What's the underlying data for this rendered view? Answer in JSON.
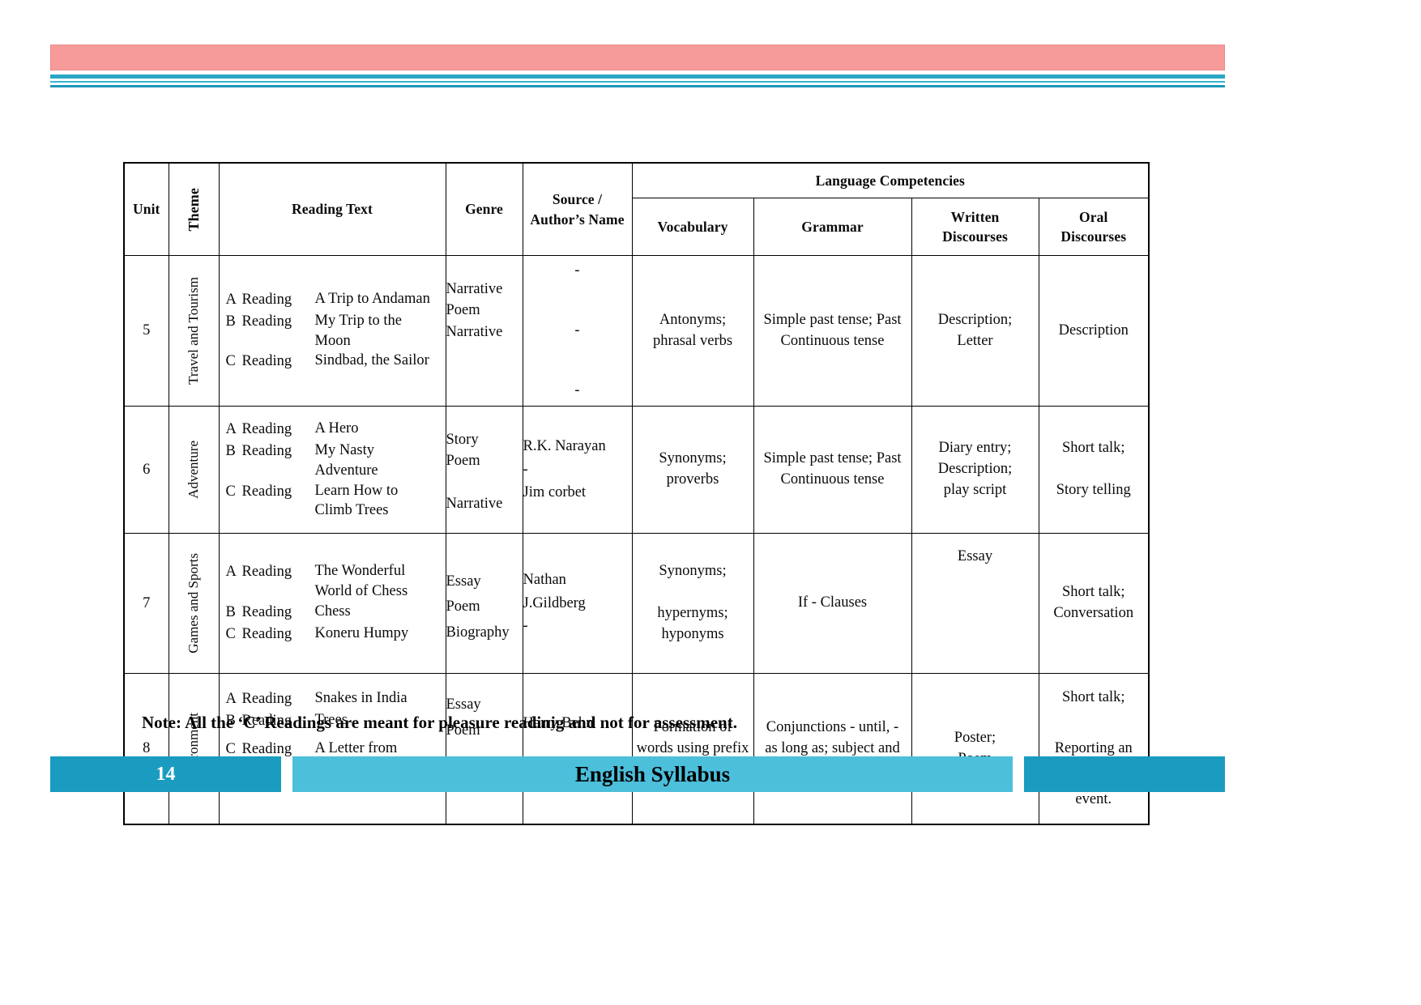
{
  "page": {
    "number": "14",
    "footer_title": "English Syllabus",
    "note": "Note: All the ‘C’ Readings are meant for pleasure readinig and not for assessment."
  },
  "colors": {
    "header_pink": "#f79a9a",
    "header_teal": "#2aa7c4",
    "footer_dark_teal": "#1a9cc0",
    "footer_light_teal": "#4cbfdb"
  },
  "table": {
    "headers": {
      "unit": "Unit",
      "theme": "Theme",
      "reading_text": "Reading Text",
      "genre": "Genre",
      "source": "Source /\nAuthor’s Name",
      "language_competencies": "Language Competencies",
      "vocabulary": "Vocabulary",
      "grammar": "Grammar",
      "written_discourses": "Written\nDiscourses",
      "oral_discourses": "Oral\nDiscourses"
    },
    "rows": [
      {
        "unit": "5",
        "theme": "Travel and\nTourism",
        "readings": [
          {
            "letter": "A",
            "label": "Reading",
            "title": "A Trip to Andaman"
          },
          {
            "letter": "B",
            "label": "Reading",
            "title": "My Trip to the Moon"
          },
          {
            "letter": "C",
            "label": "Reading",
            "title": "Sindbad, the Sailor"
          }
        ],
        "genre": "Narrative\nPoem\nNarrative",
        "source": "-\n\n-\n\n-",
        "vocabulary": "Antonyms;\nphrasal  verbs",
        "grammar": "Simple past tense; Past\nContinuous  tense",
        "written": "Description;\nLetter",
        "oral": "Description"
      },
      {
        "unit": "6",
        "theme": "Adventure",
        "readings": [
          {
            "letter": "A",
            "label": "Reading",
            "title": "A Hero"
          },
          {
            "letter": "B",
            "label": "Reading",
            "title": "My Nasty Adventure"
          },
          {
            "letter": "C",
            "label": "Reading",
            "title": "Learn How to\nClimb Trees"
          }
        ],
        "genre": "Story\nPoem\n\nNarrative",
        "source": "R.K. Narayan\n-\nJim corbet",
        "vocabulary": "Synonyms;\nproverbs",
        "grammar": "Simple past tense; Past\nContinuous  tense",
        "written": "Diary entry;\nDescription;\nplay script",
        "oral": "Short talk;\n\nStory telling"
      },
      {
        "unit": "7",
        "theme": "Games and\nSports",
        "readings": [
          {
            "letter": "A",
            "label": "Reading",
            "title": "The Wonderful\nWorld of Chess"
          },
          {
            "letter": "B",
            "label": "Reading",
            "title": "Chess"
          },
          {
            "letter": "C",
            "label": "Reading",
            "title": "Koneru Humpy"
          }
        ],
        "genre": "Essay\nPoem\nBiography",
        "source": "Nathan\nJ.Gildberg\n-",
        "vocabulary": "Synonyms;\n\nhypernyms;\nhyponyms",
        "grammar": "If - Clauses",
        "written": "Essay",
        "oral": "Short talk;\nConversation"
      },
      {
        "unit": "8",
        "theme": "Environment",
        "readings": [
          {
            "letter": "A",
            "label": "Reading",
            "title": "Snakes in India"
          },
          {
            "letter": "B",
            "label": "Reading",
            "title": "Trees"
          },
          {
            "letter": "C",
            "label": "Reading",
            "title": "A Letter from\nMother Earth"
          }
        ],
        "genre": "Essay\nPoem\n\nLetter",
        "source": "Harry Behn\n\n-",
        "vocabulary": "Formation of\nwords using prefix\nand suffix",
        "grammar": "Conjunctions - until, -\nas long as; subject and\npredicate;",
        "written": "Poster;\nPoem",
        "oral": "Short talk;\n\nReporting an\n\nevent."
      }
    ]
  }
}
